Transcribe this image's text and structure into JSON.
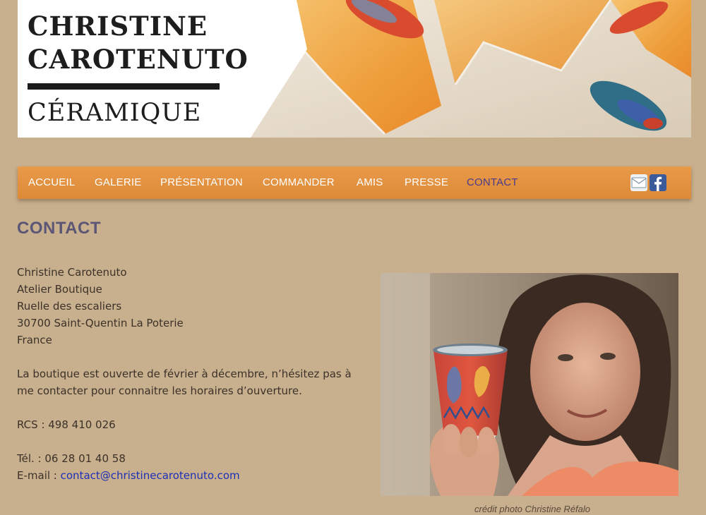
{
  "banner": {
    "title_line1": "CHRISTINE",
    "title_line2": "CAROTENUTO",
    "subtitle": "CÉRAMIQUE"
  },
  "nav": {
    "items": [
      {
        "label": "ACCUEIL"
      },
      {
        "label": "GALERIE"
      },
      {
        "label": "PRÉSENTATION"
      },
      {
        "label": "COMMANDER"
      },
      {
        "label": "AMIS"
      },
      {
        "label": "PRESSE"
      },
      {
        "label": "CONTACT",
        "active": true
      }
    ],
    "icons": [
      "mail-icon",
      "facebook-icon"
    ]
  },
  "page": {
    "title": "CONTACT"
  },
  "contact": {
    "name": "Christine Carotenuto",
    "line2": "Atelier Boutique",
    "line3": "Ruelle des escaliers",
    "line4": "30700 Saint-Quentin La Poterie",
    "line5": "France",
    "shop_text": "La boutique est ouverte de février à décembre, n’hésitez pas à me contacter pour connaitre les horaires d’ouverture.",
    "rcs": "RCS : 498 410 026",
    "phone": "Tél. : 06 28 01 40 58",
    "email_label": "E-mail : ",
    "email": "contact@christinecarotenuto.com"
  },
  "photo": {
    "credit": "crédit photo Christine Réfalo"
  },
  "colors": {
    "background": "#c8b08e",
    "nav": "#e0903d",
    "active_nav": "#4a3a8a",
    "title": "#5c5676",
    "link": "#1d2fb5"
  }
}
